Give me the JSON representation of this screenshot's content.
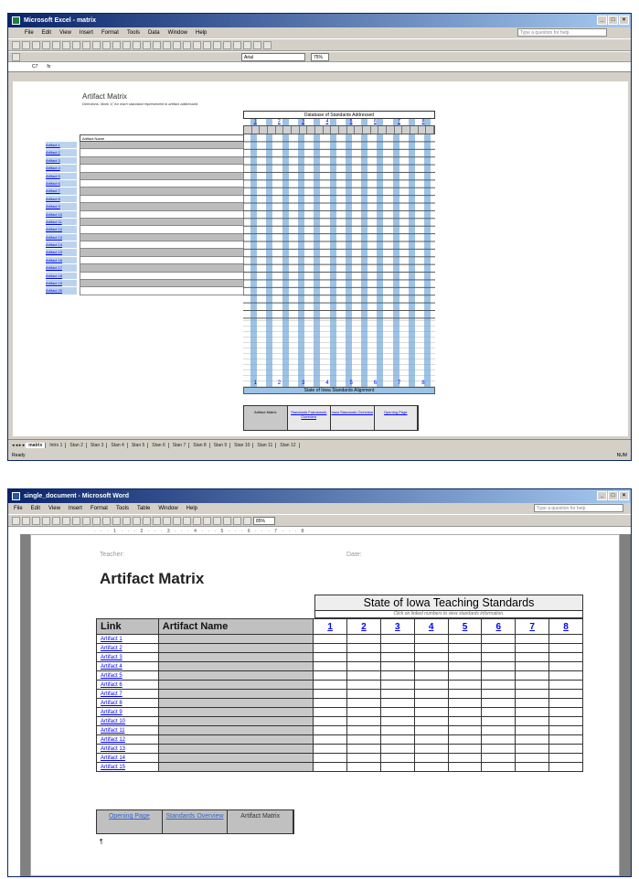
{
  "excel": {
    "title": "Microsoft Excel - matrix",
    "menu": [
      "File",
      "Edit",
      "View",
      "Insert",
      "Format",
      "Tools",
      "Data",
      "Window",
      "Help"
    ],
    "help_placeholder": "Type a question for help",
    "font": "Arial",
    "zoom": "75%",
    "cell_ref": "C7",
    "sheet_title": "Artifact Matrix",
    "sheet_subtitle": "Directions: Mark 'X' for each standard represented in artifact addressed.",
    "standards_header": "Database of Standards Addressed",
    "artifact_name_header": "Artifact Name",
    "std_numbers": [
      "1",
      "2",
      "3",
      "4",
      "5",
      "6",
      "7",
      "8"
    ],
    "links": [
      "Artifact 1",
      "Artifact 2",
      "Artifact 3",
      "Artifact 4",
      "Artifact 5",
      "Artifact 6",
      "Artifact 7",
      "Artifact 8",
      "Artifact 9",
      "Artifact 10",
      "Artifact 11",
      "Artifact 12",
      "Artifact 13",
      "Artifact 14",
      "Artifact 15",
      "Artifact 16",
      "Artifact 17",
      "Artifact 18",
      "Artifact 19",
      "Artifact 20"
    ],
    "alignment_label": "State of Iowa Standards Alignment",
    "nav": [
      "Artifact Matrix",
      "Standards Framework Overview",
      "Iowa Standards Overview",
      "Opening Page"
    ],
    "tabs": [
      "matrix",
      "Intro 1",
      "Stan 2",
      "Stan 3",
      "Stan 4",
      "Stan 5",
      "Stan 6",
      "Stan 7",
      "Stan 8",
      "Stan 9",
      "Stan 10",
      "Stan 11",
      "Stan 12"
    ],
    "status_left": "Ready",
    "status_right": "NUM"
  },
  "word": {
    "title": "single_document - Microsoft Word",
    "menu": [
      "File",
      "Edit",
      "View",
      "Insert",
      "Format",
      "Tools",
      "Table",
      "Window",
      "Help"
    ],
    "help_placeholder": "Type a question for help",
    "zoom": "85%",
    "teacher_label": "Teacher:",
    "date_label": "Date:",
    "page_title": "Artifact Matrix",
    "standards_title": "State of Iowa Teaching Standards",
    "standards_hint": "Click on linked numbers to view standards information.",
    "col_link": "Link",
    "col_artifact": "Artifact Name",
    "std_numbers": [
      "1",
      "2",
      "3",
      "4",
      "5",
      "6",
      "7",
      "8"
    ],
    "rows": [
      "Artifact 1",
      "Artifact 2",
      "Artifact 3",
      "Artifact 4",
      "Artifact 5",
      "Artifact 6",
      "Artifact 7",
      "Artifact 8",
      "Artifact 9",
      "Artifact 10",
      "Artifact 11",
      "Artifact 12",
      "Artifact 13",
      "Artifact 14",
      "Artifact 15"
    ],
    "nav": [
      {
        "label": "Opening Page",
        "link": true
      },
      {
        "label": "Standards Overview",
        "link": true
      },
      {
        "label": "Artifact Matrix",
        "link": false
      }
    ]
  }
}
